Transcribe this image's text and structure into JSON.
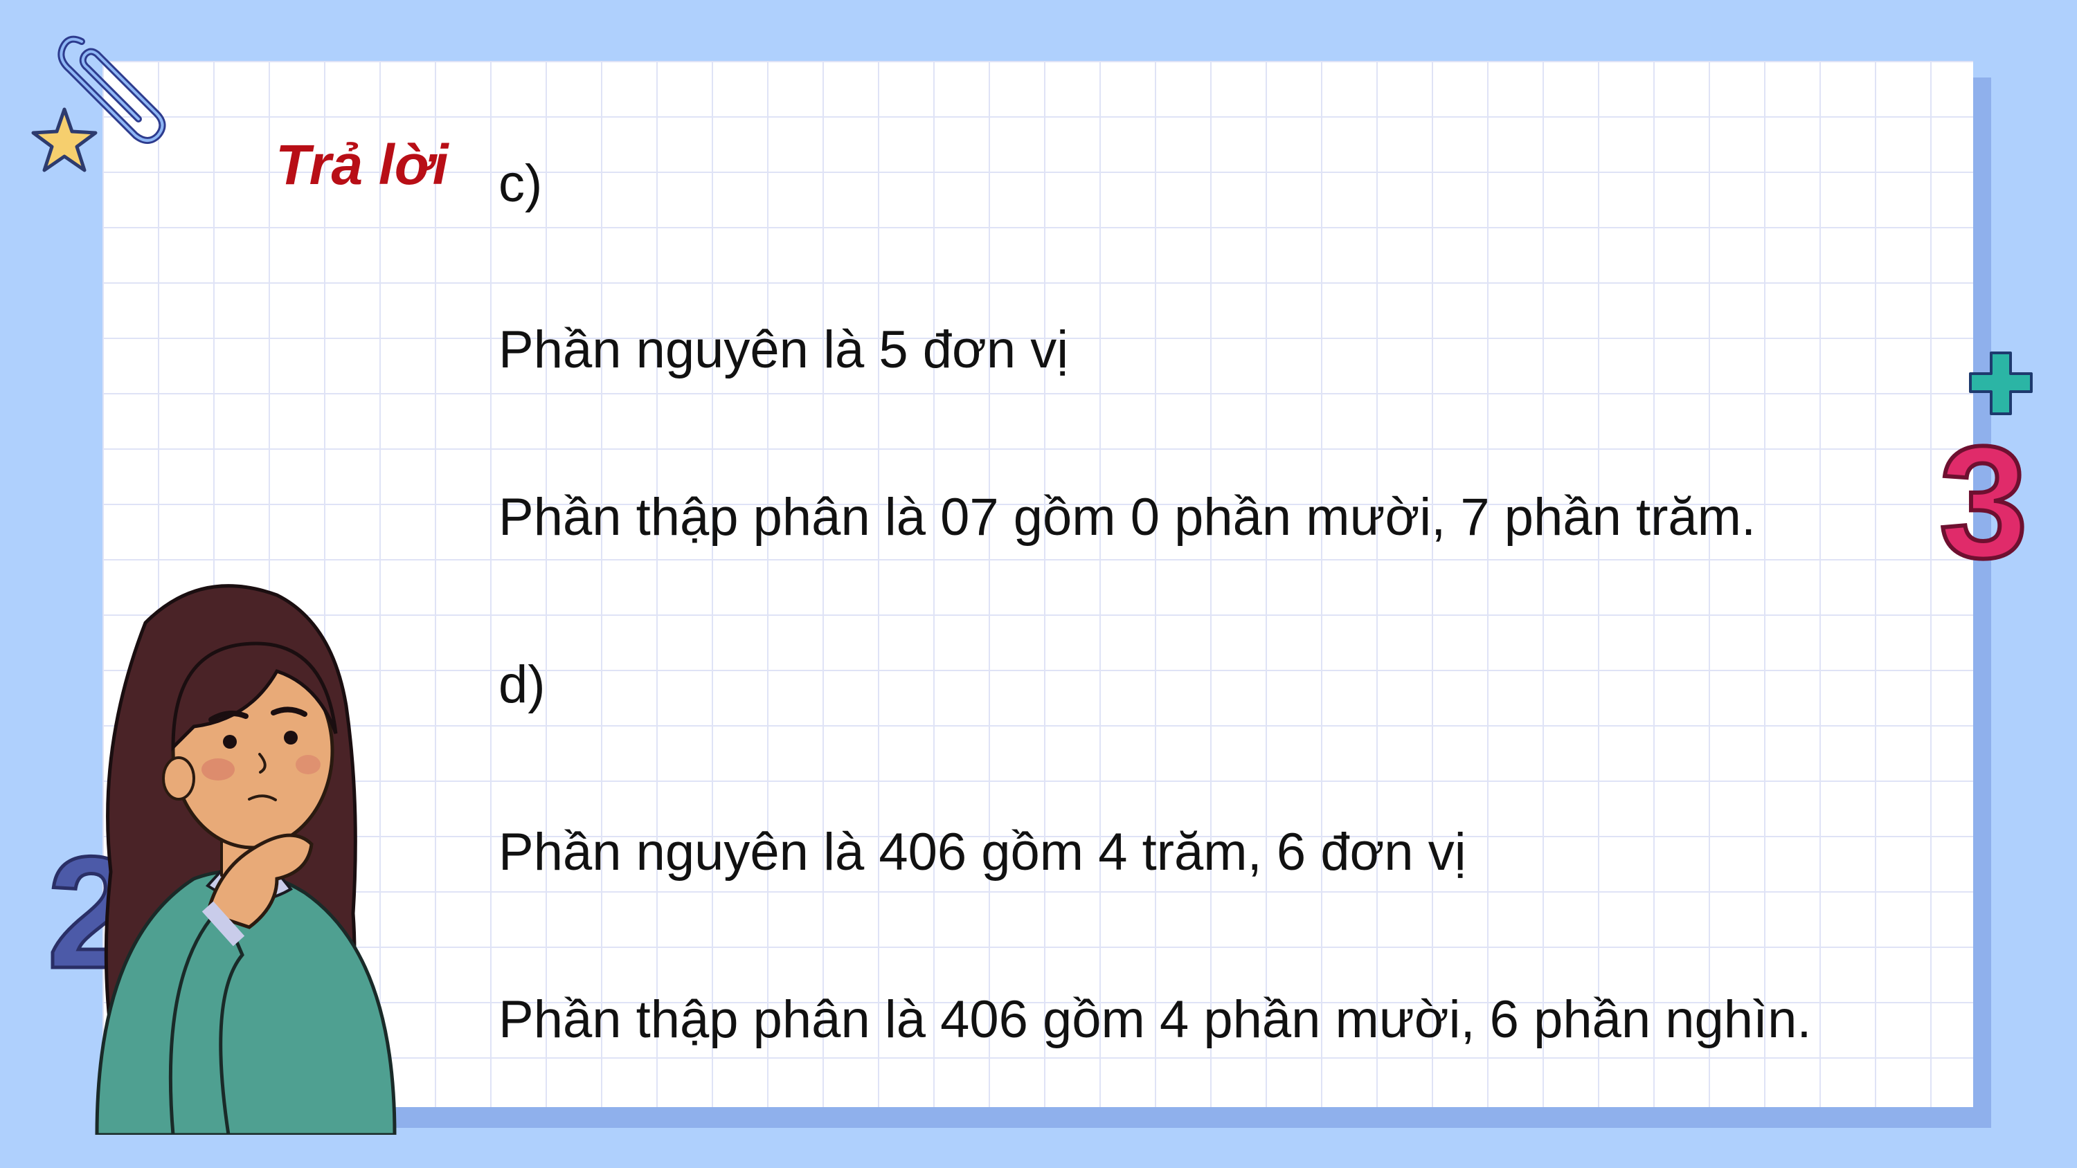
{
  "slide": {
    "answer_label": "Trả lời",
    "lines": [
      "c)",
      "Phần nguyên là 5 đơn vị",
      "Phần thập phân là 07 gồm 0 phần mười, 7 phần trăm.",
      "d)",
      "Phần nguyên là 406 gồm 4 trăm, 6 đơn vị",
      "Phần thập phân là 406 gồm 4 phần mười, 6 phần nghìn."
    ]
  },
  "decorations": {
    "number_three": "3",
    "number_two": "2",
    "plus_sign": "+"
  },
  "colors": {
    "background": "#afd0fd",
    "answer_label": "#b80e16",
    "text": "#111111",
    "plus": "#2bb5a5",
    "three": "#e02b6a",
    "two": "#4c5aa8"
  }
}
